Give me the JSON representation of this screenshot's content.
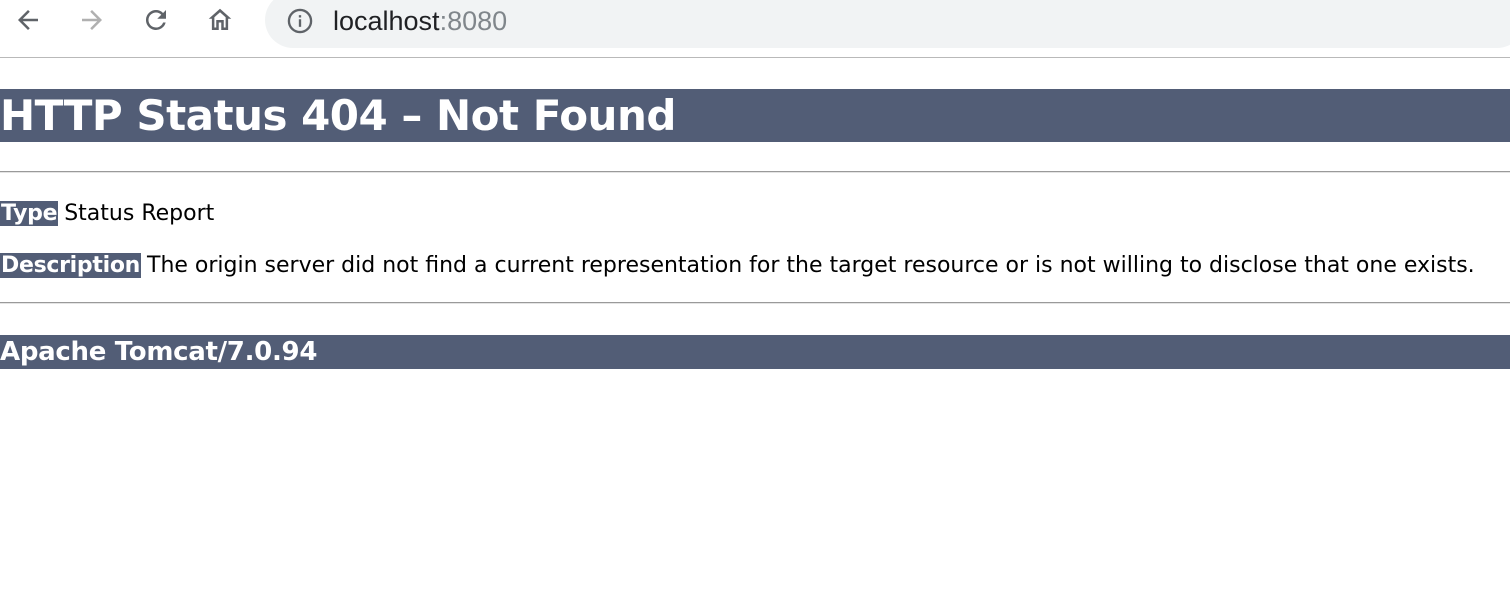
{
  "browser": {
    "address_host": "localhost",
    "address_port": ":8080",
    "icons": {
      "back": "back-arrow-icon",
      "forward": "forward-arrow-icon",
      "reload": "reload-icon",
      "home": "home-icon",
      "site_info": "info-icon"
    },
    "colors": {
      "omnibox_bg": "#f1f3f4",
      "port_text": "#80868b",
      "forward_disabled": "#b0b0b0"
    }
  },
  "page": {
    "heading": "HTTP Status 404 – Not Found",
    "type_label": "Type",
    "type_value": "Status Report",
    "description_label": "Description",
    "description_value": "The origin server did not find a current representation for the target resource or is not willing to disclose that one exists.",
    "footer": "Apache Tomcat/7.0.94",
    "colors": {
      "header_bg": "#525d76",
      "header_text": "#ffffff"
    }
  }
}
